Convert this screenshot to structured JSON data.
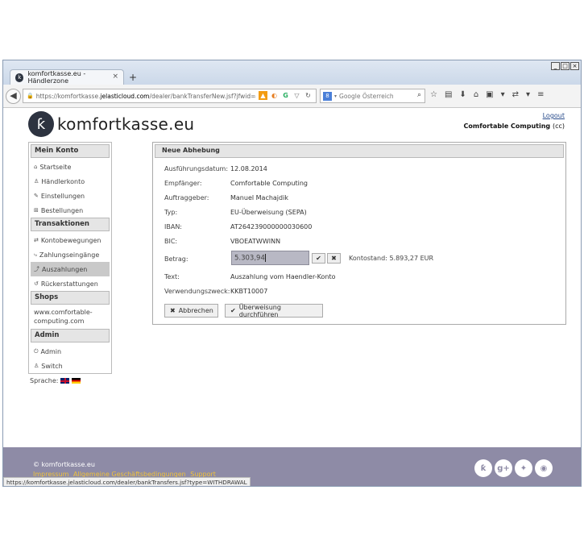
{
  "browser": {
    "tab_title": "komfortkasse.eu - Händlerzone",
    "tab_close": "×",
    "new_tab": "+",
    "url_prefix": "https://komfortkasse.",
    "url_domain": "jelasticloud.com",
    "url_path": "/dealer/bankTransferNew.jsf?jfwid=45D9604D19S",
    "search_placeholder": "Google Österreich",
    "window_min": "_",
    "window_max": "□",
    "window_close": "×"
  },
  "header": {
    "logo_text": "komfortkasse.eu",
    "logout": "Logout",
    "company_name": "Comfortable Computing",
    "company_suffix": "(cc)"
  },
  "sidebar": {
    "sections": [
      {
        "title": "Mein Konto"
      },
      {
        "title": "Transaktionen"
      },
      {
        "title": "Shops"
      },
      {
        "title": "Admin"
      }
    ],
    "mein_konto": [
      "Startseite",
      "Händlerkonto",
      "Einstellungen",
      "Bestellungen"
    ],
    "transaktionen": [
      "Kontobewegungen",
      "Zahlungseingänge",
      "Auszahlungen",
      "Rückerstattungen"
    ],
    "shop_link": "www.comfortable-computing.com",
    "admin": [
      "Admin",
      "Switch"
    ],
    "language_label": "Sprache:"
  },
  "panel": {
    "title": "Neue Abhebung",
    "fields": [
      {
        "label": "Ausführungsdatum:",
        "value": "12.08.2014"
      },
      {
        "label": "Empfänger:",
        "value": "Comfortable Computing"
      },
      {
        "label": "Auftraggeber:",
        "value": "Manuel Machajdik"
      },
      {
        "label": "Typ:",
        "value": "EU-Überweisung (SEPA)"
      },
      {
        "label": "IBAN:",
        "value": "AT264239000000030600"
      },
      {
        "label": "BIC:",
        "value": "VBOEATWWINN"
      }
    ],
    "amount_label": "Betrag:",
    "amount_value": "5.303,94",
    "balance": "Kontostand: 5.893,27 EUR",
    "text_label": "Text:",
    "text_value": "Auszahlung vom Haendler-Konto",
    "purpose_label": "Verwendungszweck:",
    "purpose_value": "KKBT10007",
    "cancel_label": "Abbrechen",
    "submit_label": "Überweisung durchführen"
  },
  "footer": {
    "copyright": "© komfortkasse.eu",
    "links": [
      "Impressum",
      "Allgemeine Geschäftsbedingungen",
      "Support"
    ]
  },
  "status_url": "https://komfortkasse.jelasticloud.com/dealer/bankTransfers.jsf?type=WITHDRAWAL"
}
